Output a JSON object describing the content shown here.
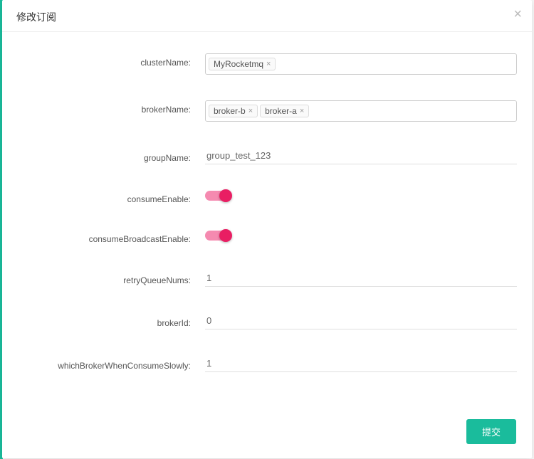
{
  "modal": {
    "title": "修改订阅",
    "submit_label": "提交"
  },
  "labels": {
    "clusterName": "clusterName:",
    "brokerName": "brokerName:",
    "groupName": "groupName:",
    "consumeEnable": "consumeEnable:",
    "consumeBroadcastEnable": "consumeBroadcastEnable:",
    "retryQueueNums": "retryQueueNums:",
    "brokerId": "brokerId:",
    "whichBrokerWhenConsumeSlowly": "whichBrokerWhenConsumeSlowly:"
  },
  "values": {
    "cluster_tags": [
      "MyRocketmq"
    ],
    "broker_tags": [
      "broker-b",
      "broker-a"
    ],
    "groupName": "group_test_123",
    "consumeEnable": true,
    "consumeBroadcastEnable": true,
    "retryQueueNums": "1",
    "brokerId": "0",
    "whichBrokerWhenConsumeSlowly": "1"
  }
}
